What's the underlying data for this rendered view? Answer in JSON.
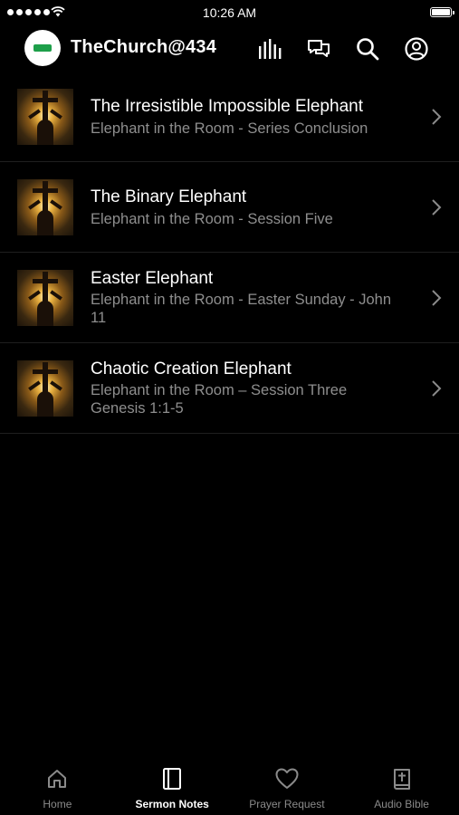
{
  "status_bar": {
    "time": "10:26 AM",
    "signal_icon": "signal-dots-icon",
    "wifi_icon": "wifi-icon",
    "battery_icon": "battery-icon",
    "battery_level": 1.0
  },
  "header": {
    "title": "TheChurch@434",
    "logo_icon": "church-logo-icon",
    "actions": [
      {
        "icon": "audio-bars-icon"
      },
      {
        "icon": "chat-bubbles-icon"
      },
      {
        "icon": "search-icon"
      },
      {
        "icon": "profile-icon"
      }
    ]
  },
  "sermons": [
    {
      "title": "The Irresistible Impossible Elephant",
      "subtitle": "Elephant in the Room - Series Conclusion"
    },
    {
      "title": "The Binary Elephant",
      "subtitle": "Elephant in the Room - Session Five"
    },
    {
      "title": "Easter Elephant",
      "subtitle": "Elephant in the Room - Easter Sunday - John 11"
    },
    {
      "title": "Chaotic Creation Elephant",
      "subtitle": "Elephant in the Room – Session Three Genesis 1:1-5"
    }
  ],
  "tabs": [
    {
      "label": "Home",
      "icon": "home-icon",
      "active": false
    },
    {
      "label": "Sermon Notes",
      "icon": "notebook-icon",
      "active": true
    },
    {
      "label": "Prayer Request",
      "icon": "heart-icon",
      "active": false
    },
    {
      "label": "Audio Bible",
      "icon": "bible-icon",
      "active": false
    }
  ],
  "colors": {
    "background": "#000000",
    "text_primary": "#ffffff",
    "text_secondary": "#8e8e8e",
    "tab_inactive": "#8a8a8a",
    "logo_green": "#1e9f4a"
  }
}
